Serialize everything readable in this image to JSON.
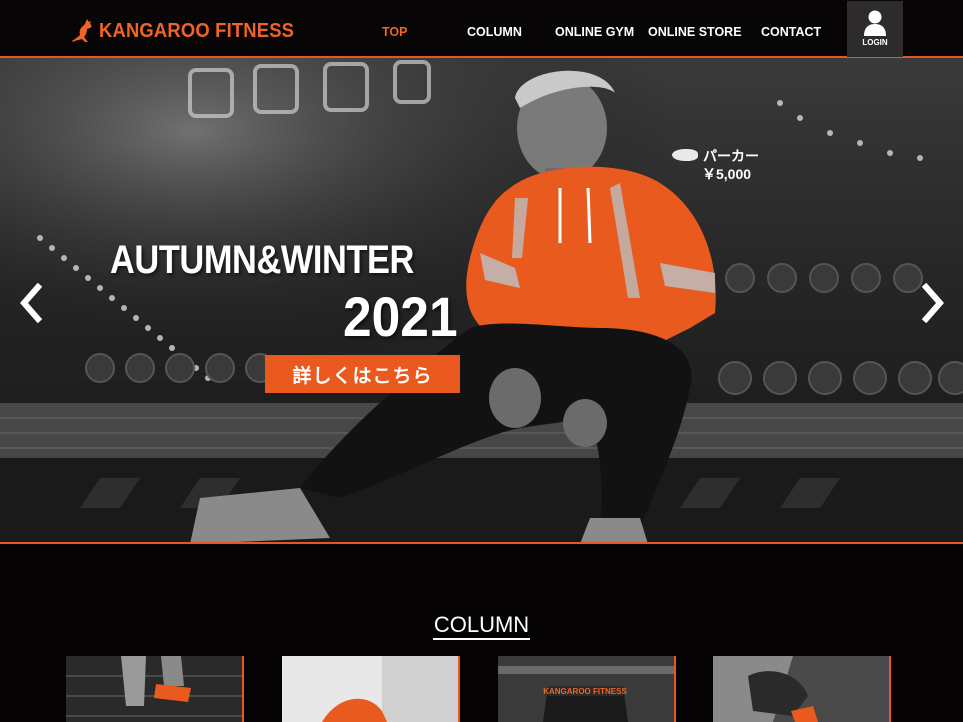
{
  "header": {
    "logo_text": "KANGAROO FITNESS",
    "nav": [
      {
        "label": "TOP",
        "active": true
      },
      {
        "label": "COLUMN",
        "active": false
      },
      {
        "label": "ONLINE GYM",
        "active": false
      },
      {
        "label": "ONLINE STORE",
        "active": false
      },
      {
        "label": "CONTACT",
        "active": false
      }
    ],
    "login_label": "LOGIN"
  },
  "hero": {
    "headline": "AUTUMN&WINTER",
    "year": "2021",
    "cta_label": "詳しくはこちら",
    "product_name": "パーカー",
    "product_price": "￥5,000"
  },
  "column_section": {
    "title": "COLUMN",
    "card_logo_text": "KANGAROO FITNESS"
  },
  "colors": {
    "accent": "#e8581c",
    "background": "#050304",
    "hoodie": "#e85a1e"
  },
  "icons": [
    "kangaroo-logo-icon",
    "user-icon",
    "chevron-left-icon",
    "chevron-right-icon"
  ]
}
